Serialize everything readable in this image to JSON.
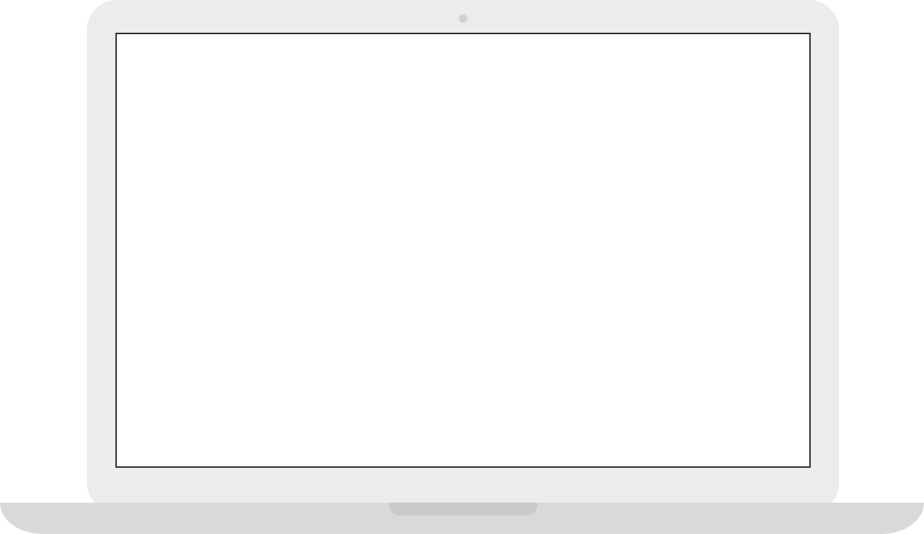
{
  "device": {
    "type": "laptop",
    "screen": {
      "content": ""
    },
    "colors": {
      "bezel": "#ececec",
      "screen": "#ffffff",
      "screen_border": "#2b2b2b",
      "camera": "#d2d2d2",
      "base": "#d9d9d9",
      "notch": "#c9c9c9"
    }
  }
}
